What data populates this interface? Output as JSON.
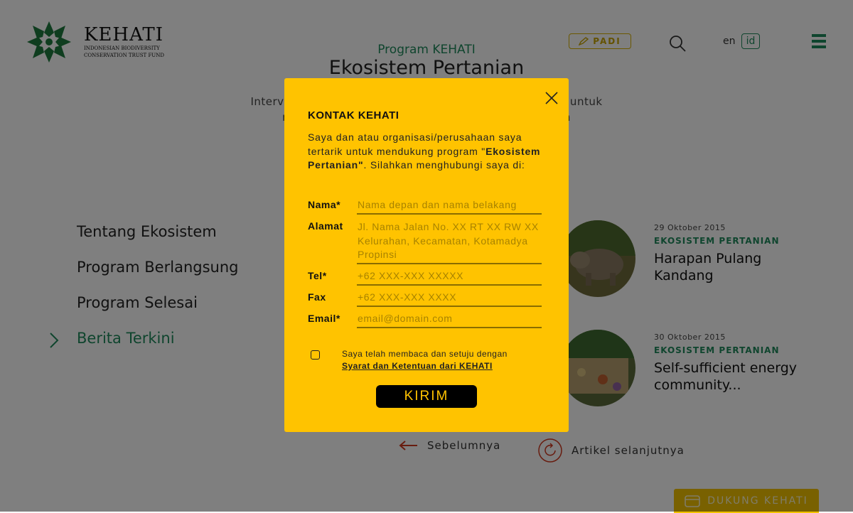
{
  "header": {
    "logo": {
      "name": "KEHATI",
      "subtitle_line1": "INDONESIAN BIODIVERSITY",
      "subtitle_line2": "CONSERVATION TRUST FUND"
    },
    "padi_label": "PADI",
    "lang_en": "en",
    "lang_id": "id"
  },
  "page": {
    "program_label": "Program KEHATI",
    "title": "Ekosistem Pertanian",
    "intro_line1": "Intervensi pad                                                   ntribusi untuk",
    "intro_line2": "mengura                                                  t dengan"
  },
  "nav": {
    "items": [
      {
        "label": "Tentang Ekosistem"
      },
      {
        "label": "Program Berlangsung"
      },
      {
        "label": "Program Selesai"
      },
      {
        "label": "Berita Terkini"
      }
    ]
  },
  "articles": [
    {
      "date": "29 Oktober 2015",
      "category": "EKOSISTEM PERTANIAN",
      "title": "Harapan Pulang Kandang"
    },
    {
      "date": "30 Oktober 2015",
      "category": "EKOSISTEM PERTANIAN",
      "title": "Self-sufficient energy community..."
    }
  ],
  "pager": {
    "prev_label": "Sebelumnya",
    "next_label": "Artikel selanjutnya"
  },
  "dukung_label": "DUKUNG KEHATI",
  "modal": {
    "title": "KONTAK KEHATI",
    "desc_prefix": "Saya dan atau organisasi/perusahaan saya tertarik untuk mendukung program \"",
    "desc_bold": "Ekosistem Pertanian\"",
    "desc_suffix": ". Silahkan menghubungi saya di:",
    "fields": {
      "nama": {
        "label": "Nama*",
        "placeholder": "Nama depan dan nama belakang"
      },
      "alamat": {
        "label": "Alamat",
        "placeholder": "Jl. Nama Jalan No. XX RT XX RW XX Kelurahan, Kecamatan, Kotamadya Propinsi"
      },
      "tel": {
        "label": "Tel*",
        "placeholder": "+62 XXX-XXX XXXXX"
      },
      "fax": {
        "label": "Fax",
        "placeholder": "+62 XXX-XXX XXXX"
      },
      "email": {
        "label": "Email*",
        "placeholder": "email@domain.com"
      }
    },
    "consent_text": "Saya telah membaca dan setuju dengan",
    "consent_link": "Syarat dan Ketentuan dari KEHATI",
    "submit_label": "KIRIM"
  },
  "colors": {
    "brand_green": "#1f8a5c",
    "modal_yellow": "#ffc300",
    "button_black": "#000000"
  }
}
